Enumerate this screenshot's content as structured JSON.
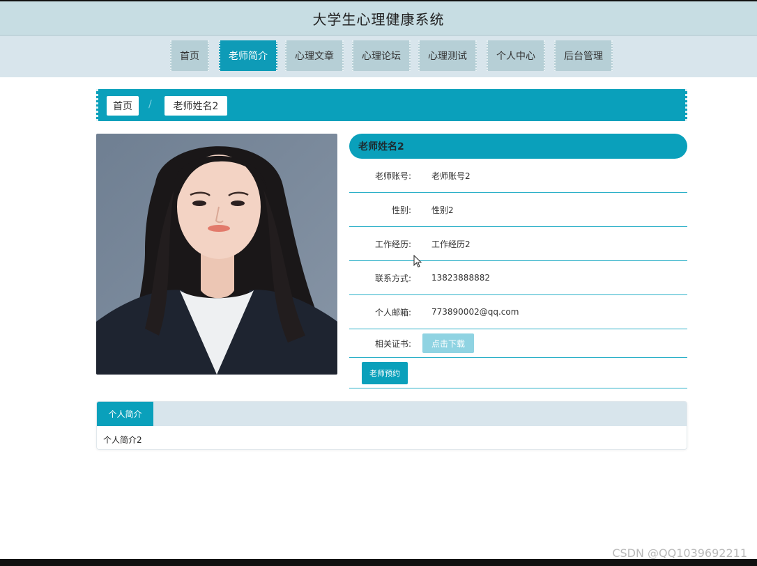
{
  "site": {
    "title": "大学生心理健康系统"
  },
  "nav": {
    "items": [
      {
        "label": "首页"
      },
      {
        "label": "老师简介"
      },
      {
        "label": "心理文章"
      },
      {
        "label": "心理论坛"
      },
      {
        "label": "心理测试"
      },
      {
        "label": "个人中心"
      },
      {
        "label": "后台管理"
      }
    ],
    "active": "老师简介"
  },
  "breadcrumb": {
    "home": "首页",
    "separator": "/",
    "current": "老师姓名2"
  },
  "teacher": {
    "name": "老师姓名2",
    "fields": [
      {
        "label": "老师账号:",
        "value": "老师账号2"
      },
      {
        "label": "性别:",
        "value": "性别2"
      },
      {
        "label": "工作经历:",
        "value": "工作经历2"
      },
      {
        "label": "联系方式:",
        "value": "13823888882"
      },
      {
        "label": "个人邮箱:",
        "value": "773890002@qq.com"
      }
    ],
    "certificate_label": "相关证书:",
    "download_label": "点击下载",
    "reserve_label": "老师预约"
  },
  "intro": {
    "tab_label": "个人简介",
    "content": "个人简介2"
  },
  "watermark": "CSDN @QQ1039692211",
  "colors": {
    "accent": "#0aa0bb",
    "title_bar": "#c7dde3",
    "nav_bg": "#d8e5ec",
    "nav_item": "#b6cfd6"
  },
  "icons": {
    "cursor": "mouse-pointer-icon",
    "photo": "teacher-portrait"
  }
}
